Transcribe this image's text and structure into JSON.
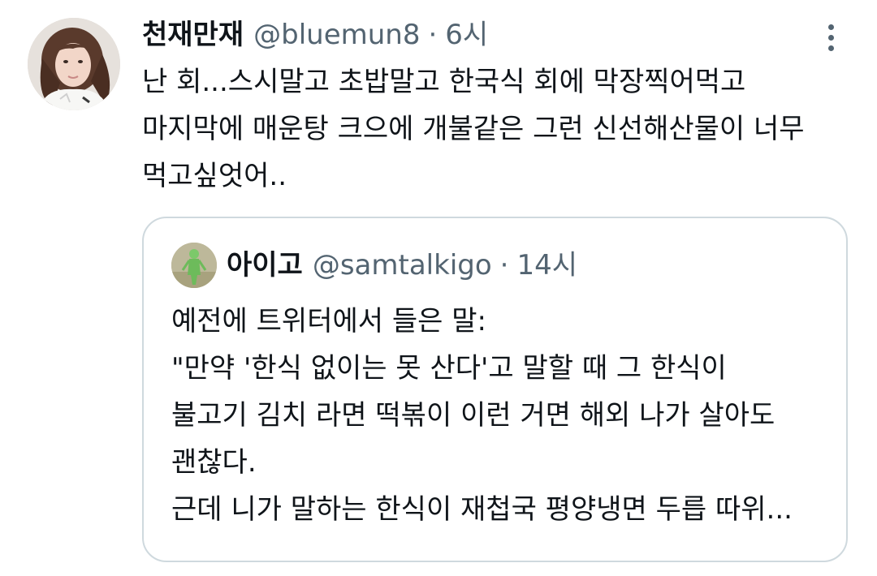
{
  "tweet": {
    "display_name": "천재만재",
    "handle": "@bluemun8",
    "separator": "·",
    "time": "6시",
    "body_lines": [
      "난 회...스시말고 초밥말고 한국식 회에 막장찍어먹고",
      "마지막에 매운탕 크으에 개불같은 그런 신선해산물이 너무",
      "먹고싶엇어.."
    ],
    "more_icon": "more-vertical-icon"
  },
  "quoted_tweet": {
    "display_name": "아이고",
    "handle": "@samtalkigo",
    "separator": "·",
    "time": "14시",
    "body_lines": [
      "예전에 트위터에서 들은 말:",
      "\"만약 '한식 없이는 못 산다'고 말할 때 그 한식이",
      "불고기 김치 라면 떡볶이 이런 거면 해외 나가 살아도",
      "괜찮다.",
      "근데 니가 말하는 한식이 재첩국 평양냉면 두릅 따위..."
    ]
  },
  "colors": {
    "text_primary": "#0f1419",
    "text_secondary": "#536471",
    "border": "#cfd9de"
  }
}
